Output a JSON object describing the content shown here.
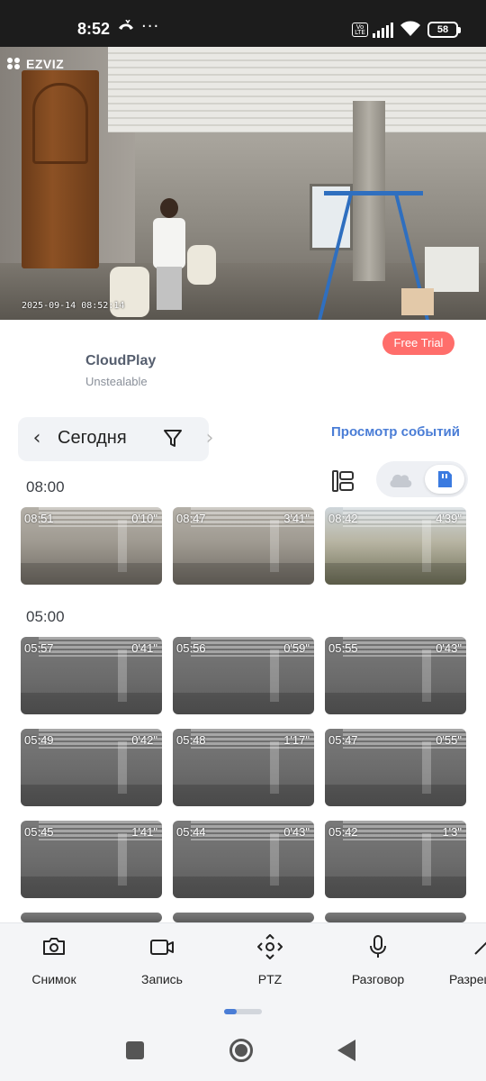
{
  "status_bar": {
    "time": "8:52",
    "battery": "58",
    "volte": "Vo LTE"
  },
  "camera": {
    "brand": "EZVIZ",
    "timestamp": "2025-09-14 08:52:14"
  },
  "cloudplay": {
    "title": "CloudPlay",
    "subtitle": "Unstealable",
    "trial_label": "Free Trial"
  },
  "date_nav": {
    "label": "Сегодня",
    "prev_icon": "chevron-left-icon",
    "next_icon": "chevron-right-icon",
    "filter_icon": "filter-icon"
  },
  "events_link": "Просмотр событий",
  "groups": [
    {
      "label": "08:00",
      "clips": [
        {
          "time": "08:51",
          "duration": "0'10\"",
          "scene": "day"
        },
        {
          "time": "08:47",
          "duration": "3'41\"",
          "scene": "day"
        },
        {
          "time": "08:42",
          "duration": "4'39\"",
          "scene": "day2"
        }
      ]
    },
    {
      "label": "05:00",
      "clips": [
        {
          "time": "05:57",
          "duration": "0'41\"",
          "scene": "night"
        },
        {
          "time": "05:56",
          "duration": "0'59\"",
          "scene": "night"
        },
        {
          "time": "05:55",
          "duration": "0'43\"",
          "scene": "night"
        },
        {
          "time": "05:49",
          "duration": "0'42\"",
          "scene": "night"
        },
        {
          "time": "05:48",
          "duration": "1'17\"",
          "scene": "night"
        },
        {
          "time": "05:47",
          "duration": "0'55\"",
          "scene": "night"
        },
        {
          "time": "05:45",
          "duration": "1'41\"",
          "scene": "night"
        },
        {
          "time": "05:44",
          "duration": "0'43\"",
          "scene": "night"
        },
        {
          "time": "05:42",
          "duration": "1'3\"",
          "scene": "night"
        }
      ]
    }
  ],
  "toolbar": [
    {
      "label": "Снимок",
      "icon": "camera-icon"
    },
    {
      "label": "Запись",
      "icon": "video-record-icon"
    },
    {
      "label": "PTZ",
      "icon": "ptz-icon"
    },
    {
      "label": "Разговор",
      "icon": "microphone-icon"
    },
    {
      "label": "Разреш",
      "icon": "resolution-icon"
    }
  ],
  "colors": {
    "accent": "#4a7dd6",
    "trial": "#ff6e6b",
    "status_bar": "#1c1c1c"
  }
}
